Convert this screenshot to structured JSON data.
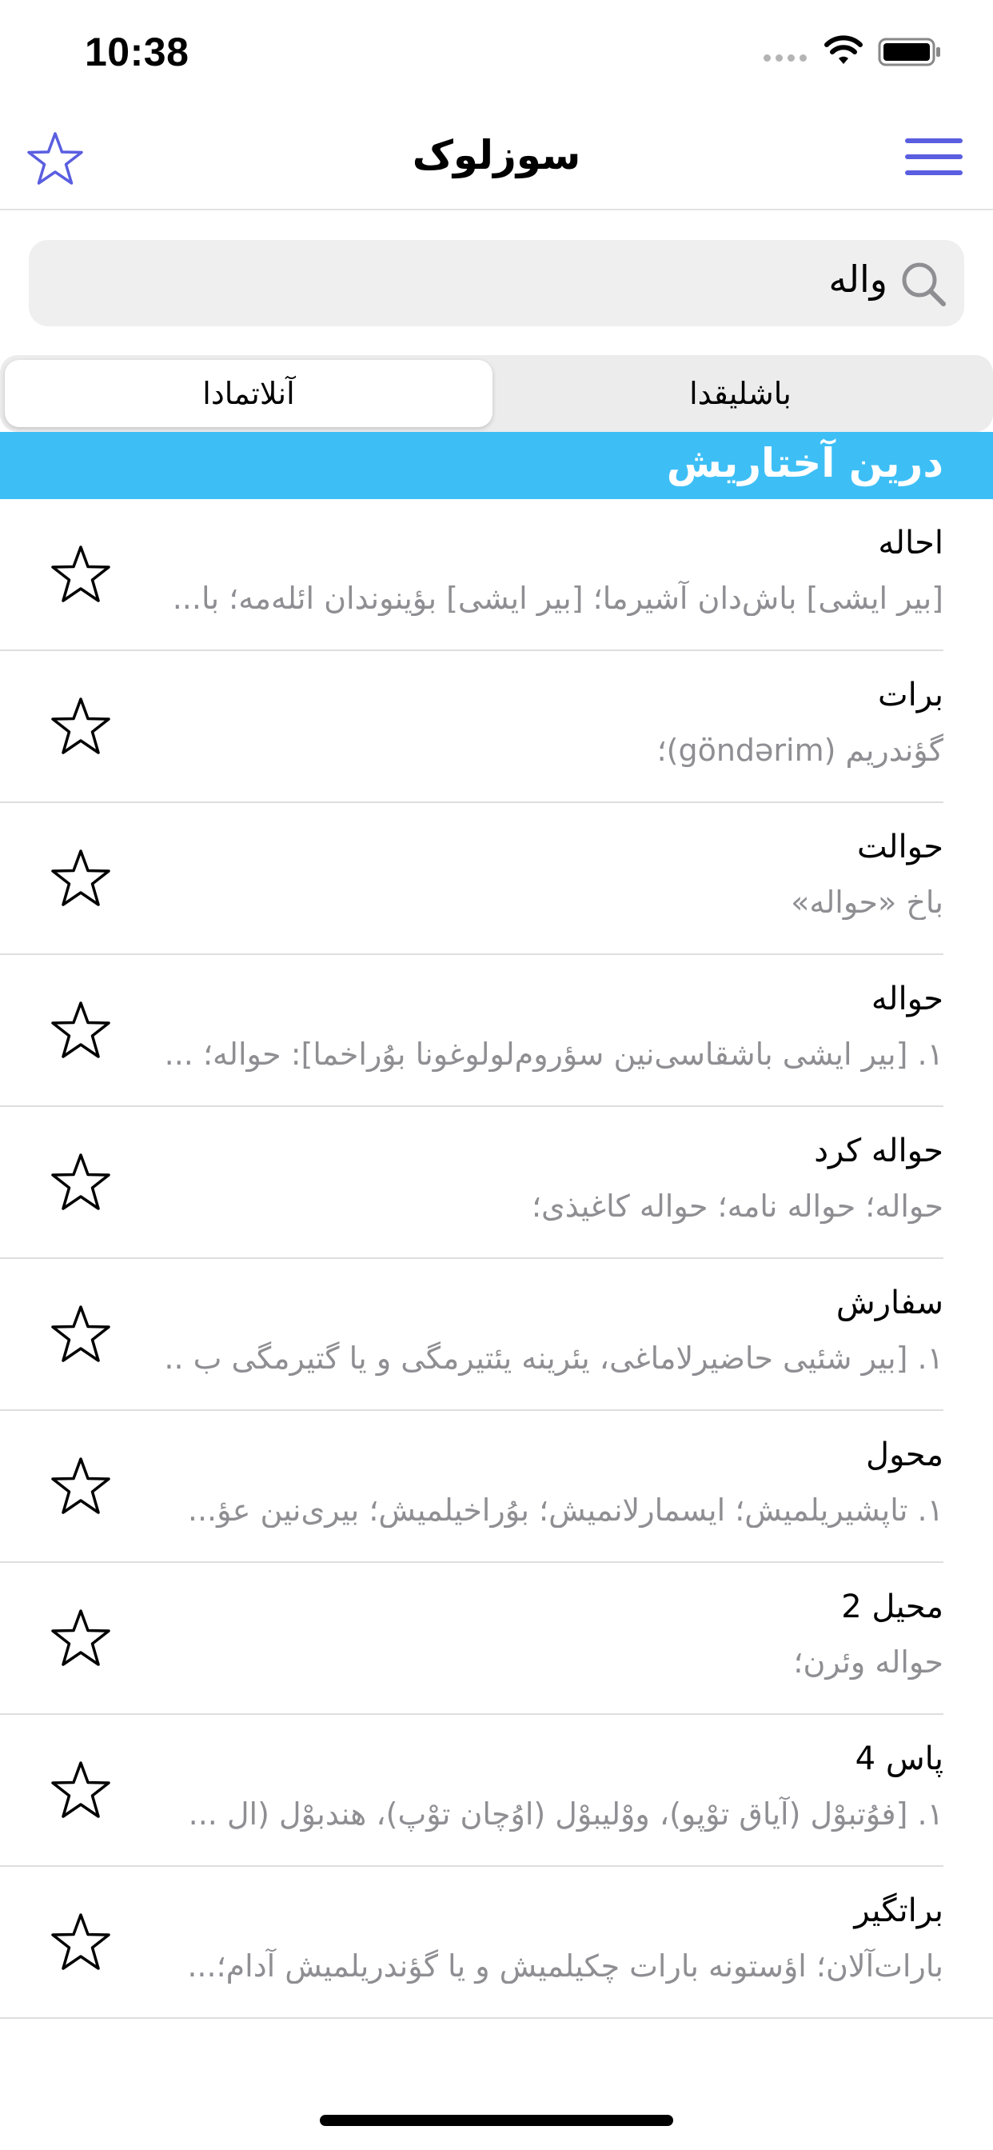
{
  "status_bar": {
    "time": "10:38"
  },
  "nav": {
    "title": "سوزلوک",
    "favorites_icon": "star-outline-icon",
    "menu_icon": "hamburger-menu-icon"
  },
  "search": {
    "value": "واله",
    "icon": "search-icon"
  },
  "segments": [
    {
      "label": "آنلاتمادا",
      "selected": true
    },
    {
      "label": "باشلیقدا",
      "selected": false
    }
  ],
  "section": {
    "title": "درین آختاریش"
  },
  "results": [
    {
      "word": "احاله",
      "definition": "[بیر ایشی] باش‌دان آشیرما؛ [بیر ایشی] بؤینوندان ائله‌مه؛ با..."
    },
    {
      "word": "برات",
      "definition": "گؤندریم (göndərim)؛"
    },
    {
      "word": "حوالت",
      "definition": "باخ «حواله»"
    },
    {
      "word": "حواله",
      "definition": "١. [بیر ایشی باشقاسی‌نین سؤروم‌لولوغونا بوُراخما]: حواله؛ ..."
    },
    {
      "word": "حواله کرد",
      "definition": "حواله؛ حواله نامه؛ حواله کاغیذی؛"
    },
    {
      "word": "سفارش",
      "definition": "١. [بیر شئیی حاضیرلاماغی، یئرینه یئتیرمگی و یا گتیرمگی ب .."
    },
    {
      "word": "محول",
      "definition": "١. تاپشیریلمیش؛ ایسمارلانمیش؛ بوُراخیلمیش؛ بیری‌نین عؤ..."
    },
    {
      "word": "محیل 2",
      "definition": "حواله وئرن؛"
    },
    {
      "word": "پاس 4",
      "definition": "١. [فوُتبوْل (آیاق توْپو)، ووْلیبوْل (اوُچان توْپ)، هندبوْل (ال ..."
    },
    {
      "word": "براتگیر",
      "definition": "بارات‌آلان؛ اؤستونه بارات چکیلمیش و یا گؤندریلمیش آدام؛..."
    }
  ],
  "colors": {
    "accent": "#5a5ee0",
    "section_header": "#3dbff6",
    "secondary_text": "#8e8e93"
  }
}
